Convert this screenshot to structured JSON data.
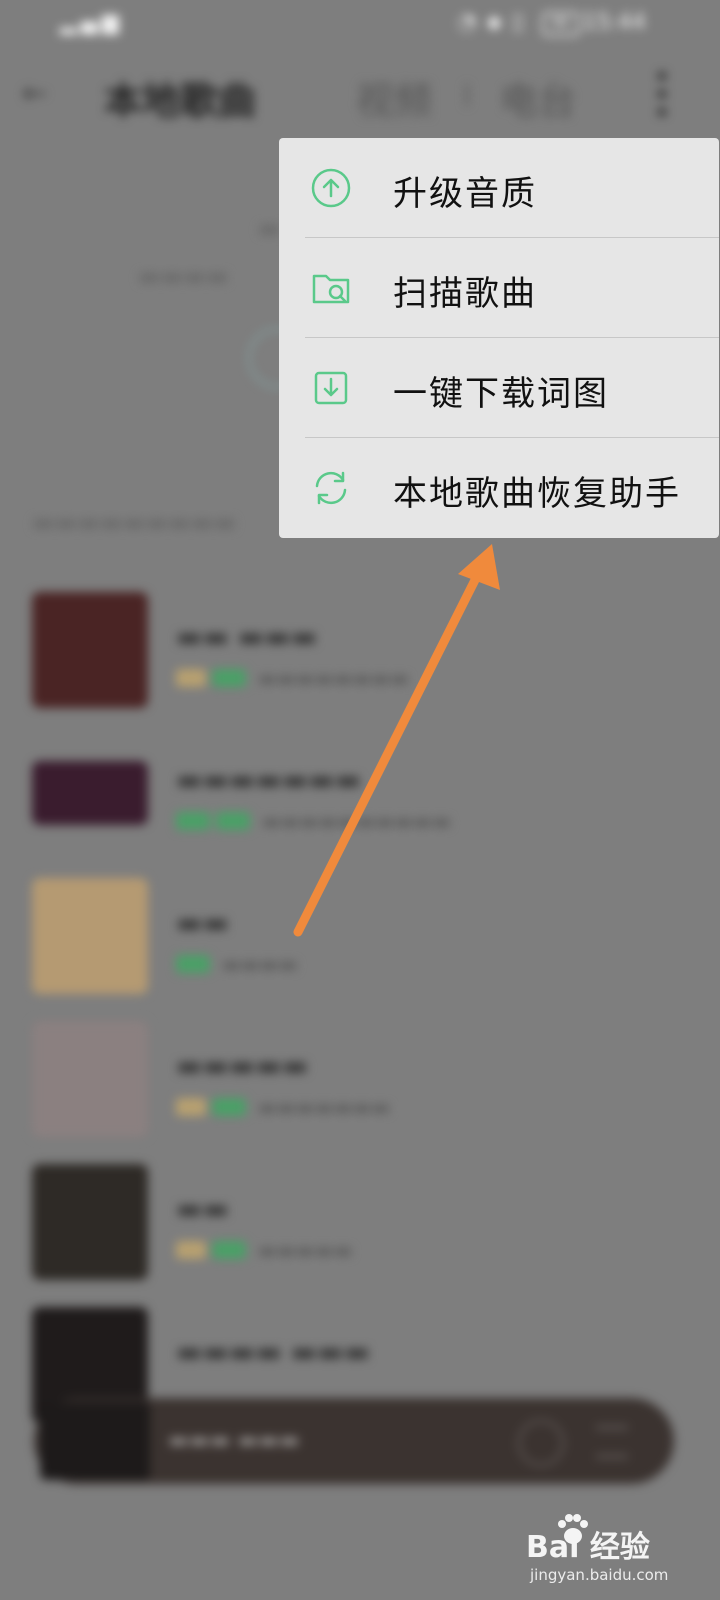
{
  "status_bar": {
    "time": "15:44",
    "battery": "80"
  },
  "header": {
    "tab_local": "本地歌曲",
    "tab_video": "视频",
    "tab_radio": "电台"
  },
  "menu": {
    "items": [
      {
        "label": "升级音质",
        "icon": "upgrade-quality-icon"
      },
      {
        "label": "扫描歌曲",
        "icon": "scan-folder-icon"
      },
      {
        "label": "一键下载词图",
        "icon": "download-icon"
      },
      {
        "label": "本地歌曲恢复助手",
        "icon": "restore-sync-icon"
      }
    ],
    "accent_color": "#5ac98a"
  },
  "annotation": {
    "arrow_color": "#f08a3c"
  },
  "watermark": {
    "brand": "Bai 经验",
    "url": "jingyan.baidu.com"
  }
}
